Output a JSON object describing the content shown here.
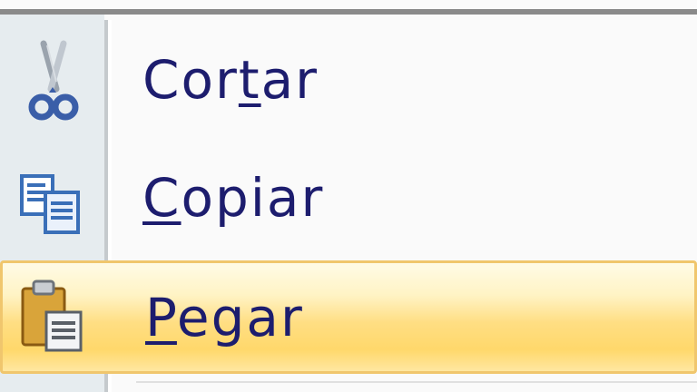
{
  "context_menu": {
    "items": [
      {
        "id": "cut",
        "label_before": "Cor",
        "mnemonic": "t",
        "label_after": "ar",
        "icon": "scissors-icon",
        "state": "normal"
      },
      {
        "id": "copy",
        "label_before": "",
        "mnemonic": "C",
        "label_after": "opiar",
        "icon": "copy-icon",
        "state": "normal"
      },
      {
        "id": "paste",
        "label_before": "",
        "mnemonic": "P",
        "label_after": "egar",
        "icon": "paste-icon",
        "state": "hover"
      }
    ]
  },
  "colors": {
    "text": "#1d1d6e",
    "icon_column": "#e6ecef",
    "hover_highlight": "#ffde83",
    "hover_border": "#f0c66d"
  }
}
